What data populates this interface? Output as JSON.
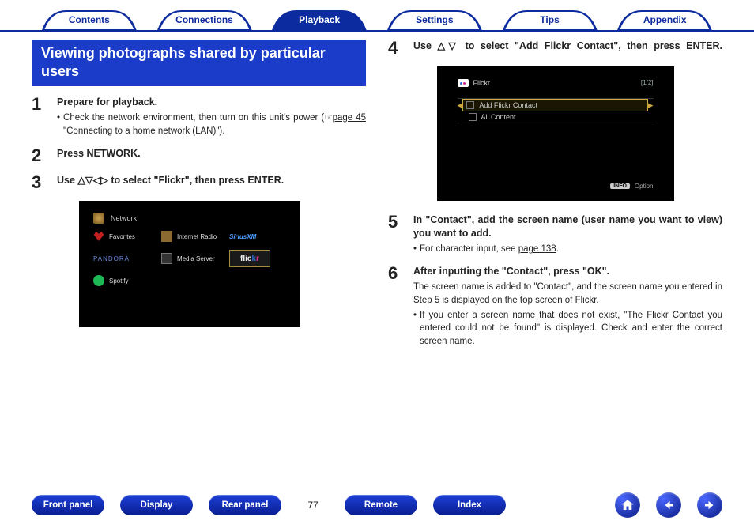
{
  "tabs": {
    "contents": "Contents",
    "connections": "Connections",
    "playback": "Playback",
    "settings": "Settings",
    "tips": "Tips",
    "appendix": "Appendix"
  },
  "section_title": "Viewing photographs shared by particular users",
  "steps": {
    "s1": {
      "num": "1",
      "head": "Prepare for playback.",
      "bullet_pre": "Check the network environment, then turn on this unit's power (",
      "bullet_link": "page 45",
      "bullet_post": " \"Connecting to a home network (LAN)\")."
    },
    "s2": {
      "num": "2",
      "head": "Press NETWORK."
    },
    "s3": {
      "num": "3",
      "head_pre": "Use ",
      "head_arrows": "△▽◁▷",
      "head_post": " to select \"Flickr\", then press ENTER."
    },
    "s4": {
      "num": "4",
      "head_pre": "Use ",
      "head_arrows": "△▽",
      "head_post": " to select \"Add Flickr Contact\", then press ENTER."
    },
    "s5": {
      "num": "5",
      "head": "In \"Contact\", add the screen name (user name you want to view) you want to add.",
      "bullet_pre": "For character input, see ",
      "bullet_link": "page 138",
      "bullet_post": "."
    },
    "s6": {
      "num": "6",
      "head": "After inputting the \"Contact\", press \"OK\".",
      "body": "The screen name is added to \"Contact\", and the screen name you entered in Step 5 is displayed on the top screen of Flickr.",
      "bullet": "If you enter a screen name that does not exist, \"The Flickr Contact you entered could not be found\" is displayed. Check and enter the correct screen name."
    }
  },
  "shot1": {
    "title": "Network",
    "items": {
      "favorites": "Favorites",
      "internet_radio": "Internet Radio",
      "siriusxm": "SiriusXM",
      "pandora": "PANDORA",
      "media_server": "Media Server",
      "flickr": "flickr",
      "spotify": "Spotify"
    }
  },
  "shot2": {
    "title": "Flickr",
    "count": "[1/2]",
    "row_sel": "Add Flickr Contact",
    "row2": "All Content",
    "option": "Option",
    "info": "INFO"
  },
  "bottom": {
    "front_panel": "Front panel",
    "display": "Display",
    "rear_panel": "Rear panel",
    "page": "77",
    "remote": "Remote",
    "index": "Index"
  },
  "icons": {
    "hand": "☞"
  }
}
